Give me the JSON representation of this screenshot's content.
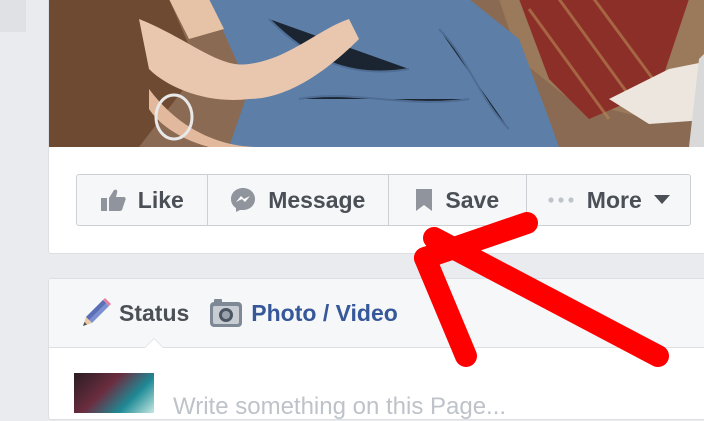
{
  "actions": [
    {
      "label": "Like",
      "icon": "thumbs-up-icon"
    },
    {
      "label": "Message",
      "icon": "messenger-icon"
    },
    {
      "label": "Save",
      "icon": "bookmark-icon"
    },
    {
      "label": "More",
      "icon": "more-dots-icon",
      "dropdown_icon": "caret-down-icon"
    }
  ],
  "composer": {
    "tabs": [
      {
        "label": "Status",
        "icon": "pencil-icon"
      },
      {
        "label": "Photo / Video",
        "icon": "camera-icon"
      }
    ],
    "placeholder": "Write something on this Page..."
  },
  "colors": {
    "page_bg": "#e9ebee",
    "button_text": "#4b4f56",
    "link_blue": "#365899",
    "annotation_arrow": "#ff0000"
  }
}
